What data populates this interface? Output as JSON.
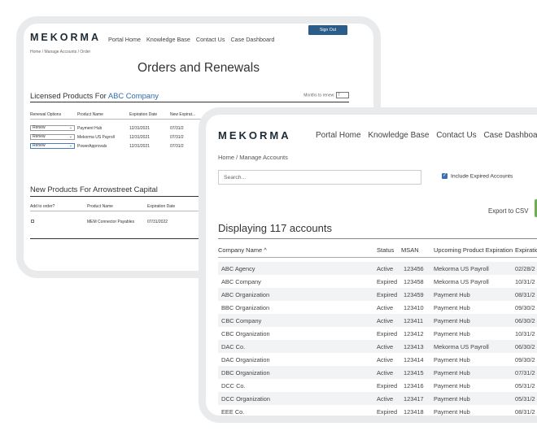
{
  "brand": {
    "logo": "MEKORMA"
  },
  "back": {
    "nav": [
      "Portal Home",
      "Knowledge Base",
      "Contact Us",
      "Case Dashboard"
    ],
    "signout": "Sign Out",
    "breadcrumb": "Home / Manage Accounts / Order",
    "title": "Orders and Renewals",
    "licensed": {
      "heading": "Licensed Products For",
      "company": "ABC Company",
      "months_label": "Months to renew:",
      "months_value": "7",
      "headers": [
        "Renewal Options",
        "Product Name",
        "Expiration Date",
        "New Expirat..."
      ],
      "rows": [
        {
          "option": "Renew",
          "product": "Payment Hub",
          "exp": "12/31/2021",
          "new": "07/31/2"
        },
        {
          "option": "Renew",
          "product": "Mekorma US Payroll",
          "exp": "12/31/2021",
          "new": "07/31/2"
        },
        {
          "option": "Renew",
          "product": "PowerApprovals",
          "exp": "12/31/2021",
          "new": "07/31/2"
        }
      ]
    },
    "new_products": {
      "heading": "New Products For Arrowstreet Capital",
      "headers": [
        "Add to order?",
        "Product Name",
        "Expiration Date"
      ],
      "rows": [
        {
          "product": "MEM Connector Payables",
          "exp": "07/31/2022"
        }
      ]
    }
  },
  "front": {
    "nav": [
      "Portal Home",
      "Knowledge Base",
      "Contact Us",
      "Case Dashboard"
    ],
    "breadcrumb": "Home / Manage Accounts",
    "search_placeholder": "Search...",
    "include_expired": "Include Expired Accounts",
    "export": "Export to CSV",
    "displaying": "Displaying 117 accounts",
    "headers": {
      "company": "Company Name ^",
      "status": "Status",
      "msan": "MSAN",
      "upcoming": "Upcoming Product Expiration",
      "expiration": "Expiratio"
    },
    "rows": [
      {
        "company": "ABC Agency",
        "status": "Active",
        "msan": "123456",
        "product": "Mekorma US Payroll",
        "date": "02/28/2"
      },
      {
        "company": "ABC Company",
        "status": "Expired",
        "msan": "123458",
        "product": "Mekorma US Payroll",
        "date": "10/31/2"
      },
      {
        "company": "ABC Organization",
        "status": "Expired",
        "msan": "123459",
        "product": "Payment Hub",
        "date": "08/31/2"
      },
      {
        "company": "BBC Organization",
        "status": "Active",
        "msan": "123410",
        "product": "Payment Hub",
        "date": "09/30/2"
      },
      {
        "company": "CBC Company",
        "status": "Active",
        "msan": "123411",
        "product": "Payment Hub",
        "date": "06/30/2"
      },
      {
        "company": "CBC Organization",
        "status": "Expired",
        "msan": "123412",
        "product": "Payment Hub",
        "date": "10/31/2"
      },
      {
        "company": "DAC Co.",
        "status": "Active",
        "msan": "123413",
        "product": "Mekorma US Payroll",
        "date": "06/30/2"
      },
      {
        "company": "DAC Organization",
        "status": "Active",
        "msan": "123414",
        "product": "Payment Hub",
        "date": "09/30/2"
      },
      {
        "company": "DBC Organization",
        "status": "Active",
        "msan": "123415",
        "product": "Payment Hub",
        "date": "07/31/2"
      },
      {
        "company": "DCC Co.",
        "status": "Expired",
        "msan": "123416",
        "product": "Payment Hub",
        "date": "05/31/2"
      },
      {
        "company": "DCC Organization",
        "status": "Active",
        "msan": "123417",
        "product": "Payment Hub",
        "date": "05/31/2"
      },
      {
        "company": "EEE Co.",
        "status": "Expired",
        "msan": "123418",
        "product": "Payment Hub",
        "date": "08/31/2"
      }
    ]
  }
}
